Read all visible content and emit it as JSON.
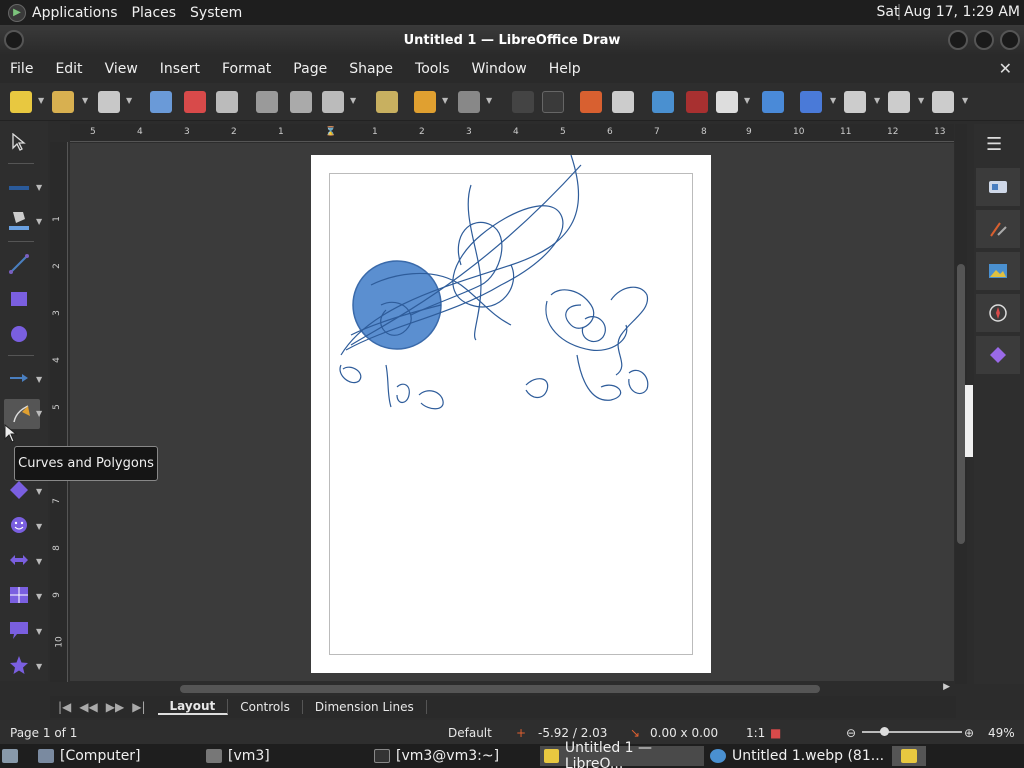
{
  "top_panel": {
    "menus": [
      "Applications",
      "Places",
      "System"
    ],
    "clock": "Sat Aug 17,  1:29 AM"
  },
  "window": {
    "title": "Untitled 1 — LibreOffice Draw"
  },
  "menubar": [
    "File",
    "Edit",
    "View",
    "Insert",
    "Format",
    "Page",
    "Shape",
    "Tools",
    "Window",
    "Help"
  ],
  "toolbar": {
    "icons": [
      "new-icon",
      "open-icon",
      "save-icon",
      "export-icon",
      "export-pdf-icon",
      "print-icon",
      "cut-icon",
      "copy-icon",
      "paste-icon",
      "clone-formatting-icon",
      "undo-icon",
      "redo-icon",
      "grid-icon",
      "helplines-icon",
      "zoom-pan-icon",
      "image-icon",
      "fontwork-icon",
      "special-character-icon",
      "text-icon",
      "transform-icon",
      "align-icon",
      "arrange-icon",
      "distribute-icon"
    ]
  },
  "ruler": {
    "horizontal_labels": [
      "5",
      "4",
      "3",
      "2",
      "1",
      "1",
      "2",
      "3",
      "4",
      "5",
      "6",
      "7",
      "8",
      "9",
      "10",
      "11",
      "12",
      "13"
    ],
    "vertical_labels": [
      "1",
      "2",
      "3",
      "4",
      "5",
      "6",
      "7",
      "8",
      "9",
      "10"
    ]
  },
  "tooltip": {
    "text": "Curves and Polygons"
  },
  "sheet_tabs": [
    "Layout",
    "Controls",
    "Dimension Lines"
  ],
  "statusbar": {
    "page": "Page 1 of 1",
    "style": "Default",
    "position": "-5.92 / 2.03",
    "size": "0.00 x 0.00",
    "scale": "1:1",
    "zoom": "49%"
  },
  "taskbar": {
    "items": [
      "[Computer]",
      "[vm3]",
      "[vm3@vm3:~]",
      "Untitled 1 — LibreO...",
      "Untitled 1.webp (81..."
    ]
  },
  "colors": {
    "accent": "#4a7fc0",
    "stroke": "#2e5c9a",
    "circle": "#5b8fd0"
  }
}
